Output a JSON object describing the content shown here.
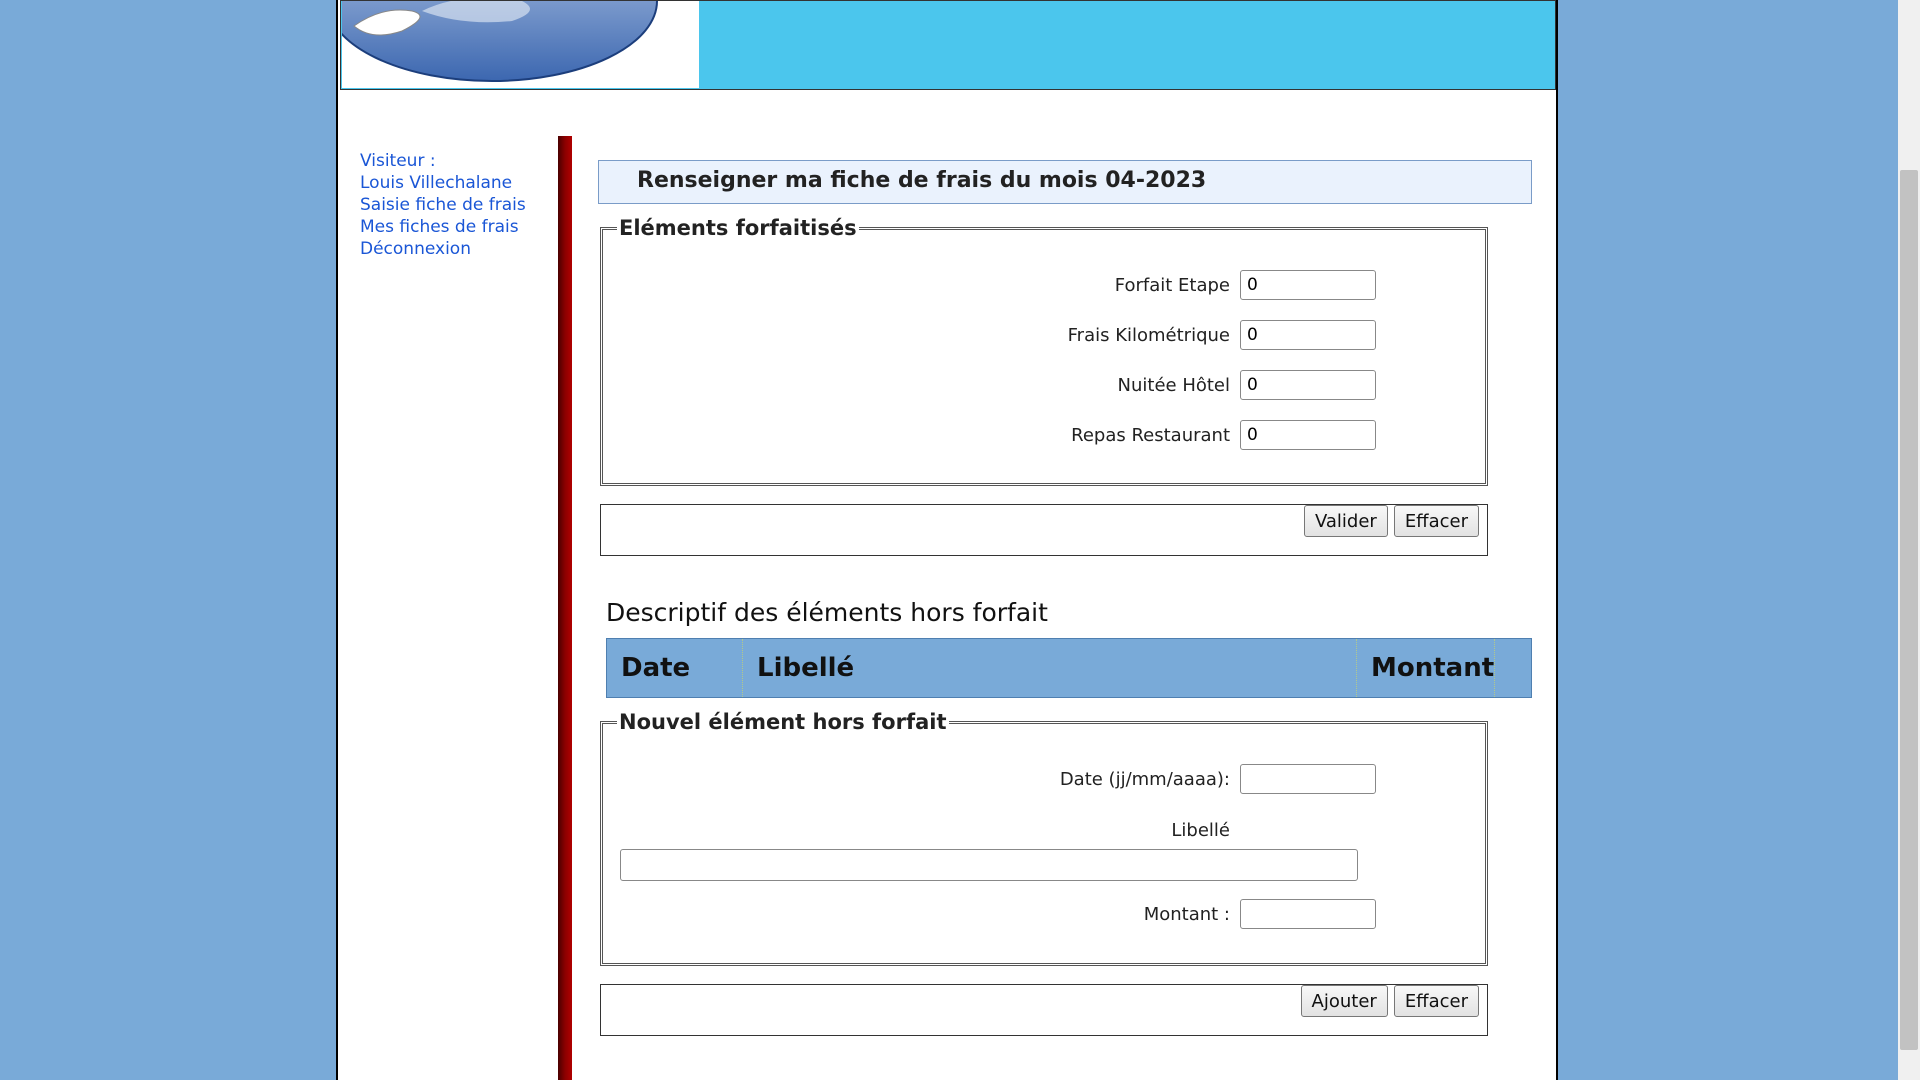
{
  "sidebar": {
    "visitor_label": "Visiteur :",
    "visitor_name": "Louis Villechalane",
    "links": [
      "Saisie fiche de frais",
      "Mes fiches de frais",
      "Déconnexion"
    ]
  },
  "page_title": "Renseigner ma fiche de frais du mois 04-2023",
  "forfait": {
    "legend": "Eléments forfaitisés",
    "fields": [
      {
        "label": "Forfait Etape",
        "value": "0"
      },
      {
        "label": "Frais Kilométrique",
        "value": "0"
      },
      {
        "label": "Nuitée Hôtel",
        "value": "0"
      },
      {
        "label": "Repas Restaurant",
        "value": "0"
      }
    ],
    "buttons": {
      "validate": "Valider",
      "clear": "Effacer"
    }
  },
  "hors_forfait": {
    "title": "Descriptif des éléments hors forfait",
    "columns": [
      "Date",
      "Libellé",
      "Montant"
    ]
  },
  "nouvel": {
    "legend": "Nouvel élément hors forfait",
    "date_label": "Date (jj/mm/aaaa):",
    "date_value": "",
    "libelle_label": "Libellé",
    "libelle_value": "",
    "montant_label": "Montant :",
    "montant_value": "",
    "buttons": {
      "add": "Ajouter",
      "clear": "Effacer"
    }
  },
  "colors": {
    "background": "#79aad8",
    "header": "#4bc6ed",
    "link": "#1a56d6",
    "divider": "#8b0000"
  }
}
